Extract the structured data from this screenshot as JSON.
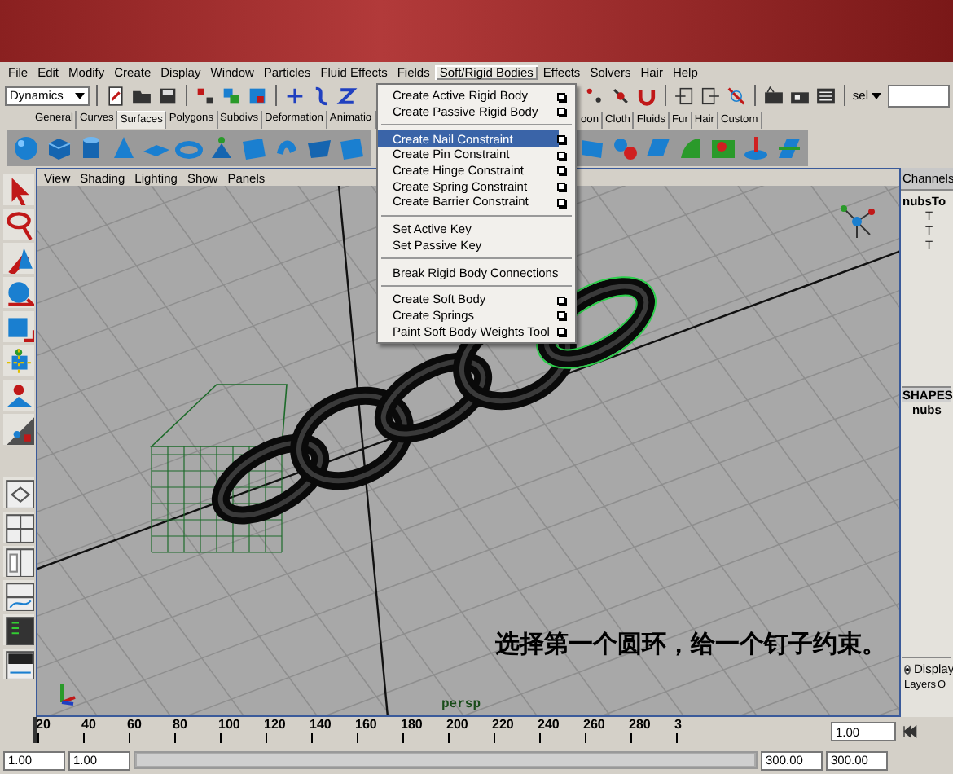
{
  "menubar": [
    {
      "label": "File",
      "selected": false
    },
    {
      "label": "Edit",
      "selected": false
    },
    {
      "label": "Modify",
      "selected": false
    },
    {
      "label": "Create",
      "selected": false
    },
    {
      "label": "Display",
      "selected": false
    },
    {
      "label": "Window",
      "selected": false
    },
    {
      "label": "Particles",
      "selected": false
    },
    {
      "label": "Fluid Effects",
      "selected": false
    },
    {
      "label": "Fields",
      "selected": false
    },
    {
      "label": "Soft/Rigid Bodies",
      "selected": true
    },
    {
      "label": "Effects",
      "selected": false
    },
    {
      "label": "Solvers",
      "selected": false
    },
    {
      "label": "Hair",
      "selected": false
    },
    {
      "label": "Help",
      "selected": false
    }
  ],
  "status_line": {
    "mode": "Dynamics",
    "selection_label": "sel"
  },
  "shelf_tabs_left": [
    {
      "label": "General",
      "selected": false
    },
    {
      "label": "Curves",
      "selected": false
    },
    {
      "label": "Surfaces",
      "selected": true
    },
    {
      "label": "Polygons",
      "selected": false
    },
    {
      "label": "Subdivs",
      "selected": false
    },
    {
      "label": "Deformation",
      "selected": false
    },
    {
      "label": "Animatio",
      "selected": false
    }
  ],
  "shelf_tabs_right": [
    {
      "label": "oon",
      "selected": false
    },
    {
      "label": "Cloth",
      "selected": false
    },
    {
      "label": "Fluids",
      "selected": false
    },
    {
      "label": "Fur",
      "selected": false
    },
    {
      "label": "Hair",
      "selected": false
    },
    {
      "label": "Custom",
      "selected": false
    }
  ],
  "open_menu": {
    "items": [
      {
        "kind": "item",
        "label": "Create Active Rigid Body",
        "options": true,
        "selected": false
      },
      {
        "kind": "item",
        "label": "Create Passive Rigid Body",
        "options": true,
        "selected": false
      },
      {
        "kind": "separator"
      },
      {
        "kind": "item",
        "label": "Create Nail Constraint",
        "options": true,
        "selected": true
      },
      {
        "kind": "item",
        "label": "Create Pin Constraint",
        "options": true,
        "selected": false
      },
      {
        "kind": "item",
        "label": "Create Hinge Constraint",
        "options": true,
        "selected": false
      },
      {
        "kind": "item",
        "label": "Create Spring Constraint",
        "options": true,
        "selected": false
      },
      {
        "kind": "item",
        "label": "Create Barrier Constraint",
        "options": true,
        "selected": false
      },
      {
        "kind": "separator"
      },
      {
        "kind": "item",
        "label": "Set Active Key",
        "options": false,
        "selected": false
      },
      {
        "kind": "item",
        "label": "Set Passive Key",
        "options": false,
        "selected": false
      },
      {
        "kind": "separator"
      },
      {
        "kind": "item",
        "label": "Break Rigid Body Connections",
        "options": false,
        "selected": false
      },
      {
        "kind": "separator"
      },
      {
        "kind": "item",
        "label": "Create Soft Body",
        "options": true,
        "selected": false
      },
      {
        "kind": "item",
        "label": "Create Springs",
        "options": true,
        "selected": false
      },
      {
        "kind": "item",
        "label": "Paint Soft Body Weights Tool",
        "options": true,
        "selected": false
      }
    ]
  },
  "panel_menu": [
    "View",
    "Shading",
    "Lighting",
    "Show",
    "Panels"
  ],
  "viewport": {
    "camera": "persp",
    "caption": "选择第一个圆环，给一个钉子约束。"
  },
  "channel_box": {
    "tab": "Channels",
    "object": "nubsTo",
    "attributes": [
      "T",
      "T",
      "T"
    ],
    "shapes_header": "SHAPES",
    "shape": "nubs"
  },
  "layer_editor": {
    "option": "Display",
    "selected": true,
    "tabs": [
      "Layers",
      "O"
    ]
  },
  "time_slider": {
    "level": 0,
    "ticks": [
      "20",
      "40",
      "60",
      "80",
      "100",
      "120",
      "140",
      "160",
      "180",
      "200",
      "220",
      "240",
      "260",
      "280",
      "3"
    ],
    "current": "1.00"
  },
  "range_slider": {
    "level": 1,
    "start": "1.00",
    "range_start": "1.00",
    "range_end": "300.00",
    "end": "300.00"
  }
}
